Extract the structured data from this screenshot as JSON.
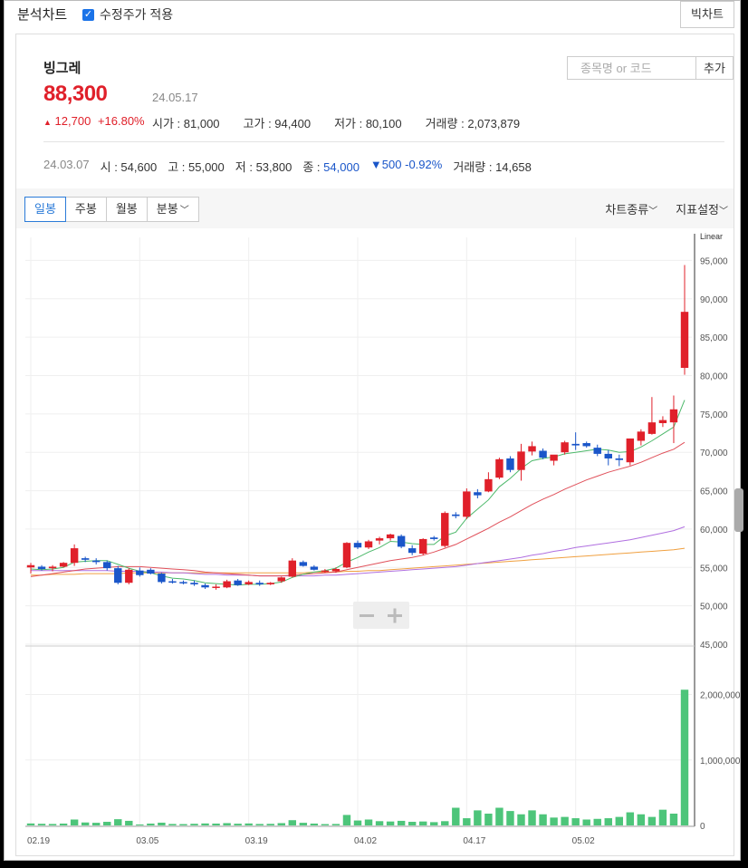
{
  "header": {
    "title": "분석차트",
    "adjusted_label": "수정주가 적용",
    "big_chart_label": "빅차트"
  },
  "stock": {
    "name": "빙그레",
    "price": "88,300",
    "date": "24.05.17",
    "change": "12,700",
    "change_pct": "+16.80%",
    "open_label": "시가",
    "open": "81,000",
    "high_label": "고가",
    "high": "94,400",
    "low_label": "저가",
    "low": "80,100",
    "volume_label": "거래량",
    "volume": "2,073,879"
  },
  "search": {
    "placeholder": "종목명 or 코드",
    "add_label": "추가"
  },
  "cursor": {
    "date": "24.03.07",
    "open_label": "시",
    "open": "54,600",
    "high_label": "고",
    "high": "55,000",
    "low_label": "저",
    "low": "53,800",
    "close_label": "종",
    "close": "54,000",
    "change": "500",
    "change_pct": "-0.92%",
    "volume_label": "거래량",
    "volume": "14,658"
  },
  "toolbar": {
    "tabs": [
      "일봉",
      "주봉",
      "월봉",
      "분봉"
    ],
    "active_tab": 0,
    "chart_type_label": "차트종류",
    "indicator_label": "지표설정"
  },
  "colors": {
    "up": "#e0202a",
    "down": "#1a56c9",
    "volume": "#4dc57a",
    "ma5": "#4cb86a",
    "ma20": "#e0505a",
    "ma60": "#b06fe0",
    "ma120": "#f0a040"
  },
  "chart_data": {
    "type": "candlestick",
    "scale_label": "Linear",
    "price_ylim": [
      45000,
      98000
    ],
    "price_ticks": [
      "95,000",
      "90,000",
      "85,000",
      "80,000",
      "75,000",
      "70,000",
      "65,000",
      "60,000",
      "55,000",
      "50,000",
      "45,000"
    ],
    "volume_ylim": [
      0,
      2700000
    ],
    "volume_ticks": [
      "2,000,000",
      "1,000,000",
      "0"
    ],
    "x_labels": [
      "02.19",
      "03.05",
      "03.19",
      "04.02",
      "04.17",
      "05.02"
    ],
    "x_label_indices": [
      0,
      10,
      20,
      30,
      40,
      50
    ],
    "candles": [
      [
        55000,
        55600,
        54200,
        55300
      ],
      [
        55100,
        55300,
        54600,
        54800
      ],
      [
        54900,
        55300,
        54500,
        55100
      ],
      [
        55100,
        55700,
        55000,
        55600
      ],
      [
        55600,
        58000,
        55200,
        57500
      ],
      [
        56200,
        56400,
        55700,
        56000
      ],
      [
        55900,
        56200,
        55400,
        55700
      ],
      [
        55700,
        55900,
        54600,
        54900
      ],
      [
        54900,
        55200,
        52800,
        53000
      ],
      [
        53000,
        54900,
        52800,
        54700
      ],
      [
        54600,
        55000,
        53800,
        54000
      ],
      [
        54700,
        54900,
        54100,
        54200
      ],
      [
        54200,
        54300,
        52900,
        53100
      ],
      [
        53200,
        53500,
        52900,
        53100
      ],
      [
        53100,
        53300,
        52800,
        53000
      ],
      [
        53000,
        53300,
        52600,
        52800
      ],
      [
        52700,
        52900,
        52200,
        52400
      ],
      [
        52400,
        52800,
        52100,
        52500
      ],
      [
        52400,
        53400,
        52300,
        53200
      ],
      [
        53300,
        53500,
        52600,
        52700
      ],
      [
        52800,
        53300,
        52700,
        53100
      ],
      [
        53000,
        53300,
        52600,
        52800
      ],
      [
        52800,
        53100,
        52700,
        53000
      ],
      [
        53200,
        53800,
        53000,
        53700
      ],
      [
        53800,
        56200,
        53700,
        55900
      ],
      [
        55700,
        55900,
        55100,
        55200
      ],
      [
        55100,
        55300,
        54600,
        54700
      ],
      [
        54500,
        54800,
        54300,
        54600
      ],
      [
        54500,
        55000,
        54300,
        54800
      ],
      [
        55000,
        58300,
        54900,
        58200
      ],
      [
        58200,
        58500,
        57400,
        57600
      ],
      [
        57600,
        58600,
        57400,
        58400
      ],
      [
        58500,
        59000,
        58000,
        58800
      ],
      [
        58800,
        59400,
        58500,
        59300
      ],
      [
        59100,
        59300,
        57500,
        57700
      ],
      [
        57500,
        57900,
        56600,
        56900
      ],
      [
        56800,
        58800,
        56600,
        58700
      ],
      [
        58900,
        59100,
        58500,
        58700
      ],
      [
        57800,
        62300,
        57600,
        62100
      ],
      [
        61900,
        62200,
        61400,
        61700
      ],
      [
        61600,
        65300,
        61300,
        64900
      ],
      [
        64800,
        65200,
        64000,
        64400
      ],
      [
        64900,
        67400,
        64800,
        66500
      ],
      [
        66700,
        69300,
        66500,
        69100
      ],
      [
        69200,
        69500,
        67400,
        67700
      ],
      [
        67700,
        71100,
        66300,
        70100
      ],
      [
        70100,
        71400,
        69600,
        70800
      ],
      [
        70200,
        70500,
        69100,
        69300
      ],
      [
        68900,
        69600,
        68300,
        69700
      ],
      [
        70000,
        71500,
        69700,
        71300
      ],
      [
        71100,
        72600,
        70300,
        70900
      ],
      [
        71200,
        71400,
        70600,
        70800
      ],
      [
        70600,
        71000,
        69500,
        69800
      ],
      [
        69800,
        70300,
        68300,
        69200
      ],
      [
        69200,
        69700,
        68200,
        69000
      ],
      [
        68700,
        71800,
        68300,
        71800
      ],
      [
        71500,
        73000,
        70900,
        72700
      ],
      [
        72400,
        77200,
        72300,
        73900
      ],
      [
        73800,
        74700,
        73300,
        74200
      ],
      [
        73900,
        77400,
        71200,
        75600
      ],
      [
        81000,
        94400,
        80100,
        88300
      ]
    ],
    "volume": [
      30000,
      25000,
      22000,
      28000,
      90000,
      45000,
      40000,
      55000,
      95000,
      70000,
      14658,
      28000,
      42000,
      22000,
      20000,
      25000,
      30000,
      28000,
      35000,
      26000,
      30000,
      22000,
      24000,
      35000,
      80000,
      40000,
      28000,
      20000,
      22000,
      160000,
      75000,
      90000,
      65000,
      60000,
      70000,
      55000,
      60000,
      50000,
      65000,
      270000,
      110000,
      230000,
      180000,
      270000,
      220000,
      170000,
      230000,
      170000,
      120000,
      130000,
      110000,
      90000,
      100000,
      110000,
      130000,
      200000,
      170000,
      130000,
      240000,
      180000,
      2073879
    ],
    "ma5": [
      54800,
      54700,
      54800,
      55000,
      55700,
      55800,
      55900,
      55900,
      55400,
      54900,
      54500,
      54300,
      53900,
      53600,
      53500,
      53300,
      53000,
      52900,
      52800,
      52700,
      52800,
      52800,
      52900,
      53100,
      53700,
      54100,
      54400,
      54600,
      54900,
      55700,
      56300,
      57000,
      57600,
      58400,
      58300,
      58100,
      58000,
      58000,
      59100,
      59600,
      61400,
      62600,
      63800,
      65500,
      66600,
      67900,
      68900,
      69200,
      69400,
      69800,
      70000,
      70200,
      70400,
      70300,
      70000,
      70100,
      70700,
      71500,
      72400,
      73300,
      76800
    ],
    "ma20": [
      53800,
      54000,
      54200,
      54400,
      54600,
      54800,
      54900,
      55000,
      55100,
      55100,
      55100,
      55000,
      54900,
      54800,
      54700,
      54600,
      54400,
      54300,
      54200,
      54100,
      54000,
      53900,
      53900,
      53900,
      54000,
      54100,
      54200,
      54300,
      54400,
      54700,
      55000,
      55300,
      55600,
      55900,
      56100,
      56300,
      56600,
      57000,
      57500,
      58000,
      58700,
      59400,
      60100,
      60900,
      61600,
      62400,
      63200,
      63900,
      64500,
      65200,
      65800,
      66400,
      66900,
      67400,
      67800,
      68200,
      68700,
      69300,
      69900,
      70400,
      71300
    ],
    "ma60": [
      54600,
      54600,
      54600,
      54600,
      54600,
      54600,
      54600,
      54600,
      54500,
      54500,
      54500,
      54400,
      54400,
      54300,
      54300,
      54200,
      54100,
      54100,
      54000,
      54000,
      54000,
      53900,
      53900,
      53900,
      53900,
      53900,
      53900,
      54000,
      54000,
      54100,
      54200,
      54300,
      54400,
      54500,
      54600,
      54700,
      54800,
      54900,
      55000,
      55100,
      55300,
      55500,
      55700,
      55900,
      56100,
      56300,
      56600,
      56800,
      57100,
      57300,
      57600,
      57800,
      58000,
      58200,
      58400,
      58600,
      58900,
      59200,
      59500,
      59800,
      60300
    ],
    "ma120": [
      54000,
      54000,
      54100,
      54100,
      54100,
      54200,
      54200,
      54200,
      54200,
      54300,
      54300,
      54300,
      54300,
      54300,
      54300,
      54300,
      54300,
      54300,
      54300,
      54300,
      54300,
      54300,
      54300,
      54300,
      54300,
      54300,
      54400,
      54400,
      54400,
      54500,
      54500,
      54600,
      54600,
      54700,
      54800,
      54900,
      55000,
      55100,
      55200,
      55300,
      55400,
      55500,
      55600,
      55700,
      55800,
      55900,
      56000,
      56100,
      56200,
      56300,
      56400,
      56500,
      56600,
      56700,
      56800,
      56900,
      57000,
      57100,
      57200,
      57300,
      57500
    ]
  }
}
